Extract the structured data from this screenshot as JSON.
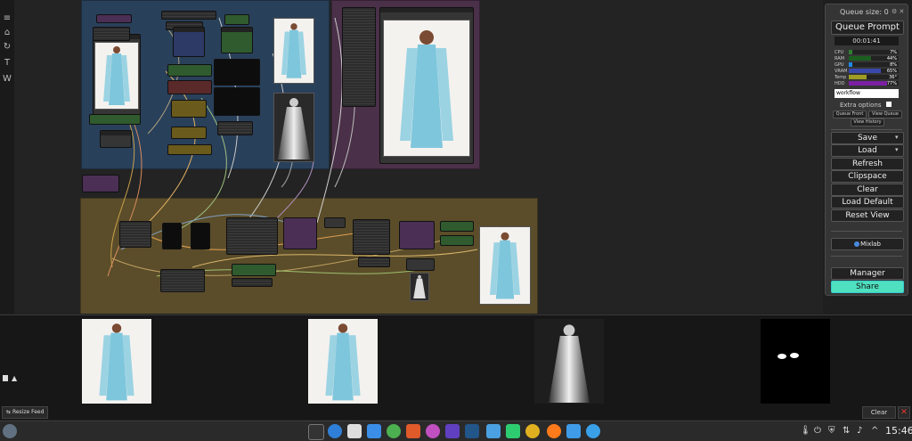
{
  "left_toolbar": {
    "items": [
      {
        "icon": "menu-icon",
        "glyph": "≡"
      },
      {
        "icon": "home-icon",
        "glyph": "⌂"
      },
      {
        "icon": "refresh-icon",
        "glyph": "↻"
      },
      {
        "icon": "text-icon",
        "glyph": "T"
      },
      {
        "icon": "workflow-icon",
        "glyph": "W"
      }
    ]
  },
  "queue_panel": {
    "queue_size_label": "Queue size: 0",
    "queue_prompt_label": "Queue Prompt",
    "timer": "00:01:41",
    "monitors": [
      {
        "label": "CPU",
        "percent": "7%",
        "value": 0.07,
        "color": "#2e7d32"
      },
      {
        "label": "RAM",
        "percent": "44%",
        "value": 0.44,
        "color": "#1b5e20"
      },
      {
        "label": "GPU",
        "percent": "8%",
        "value": 0.08,
        "color": "#1e88e5"
      },
      {
        "label": "VRAM",
        "percent": "65%",
        "value": 0.65,
        "color": "#3949ab"
      },
      {
        "label": "Temp",
        "percent": "36°",
        "value": 0.36,
        "color": "#9e9d24"
      },
      {
        "label": "HDD",
        "percent": "77%",
        "value": 0.77,
        "color": "#7b1fa2"
      }
    ],
    "workflow_field": "workflow",
    "extra_options_label": "Extra options",
    "queue_front_label": "Queue Front",
    "view_queue_label": "View Queue",
    "view_history_label": "View History",
    "save_label": "Save",
    "load_label": "Load",
    "refresh_label": "Refresh",
    "clipspace_label": "Clipspace",
    "clear_label": "Clear",
    "load_default_label": "Load Default",
    "reset_view_label": "Reset View",
    "mixlab_label": "Mixlab",
    "manager_label": "Manager",
    "share_label": "Share",
    "share_color": "#4fe0c0"
  },
  "feed": {
    "resize_label": "Resize Feed",
    "clear_label": "Clear"
  },
  "taskbar": {
    "time": "15:46"
  }
}
